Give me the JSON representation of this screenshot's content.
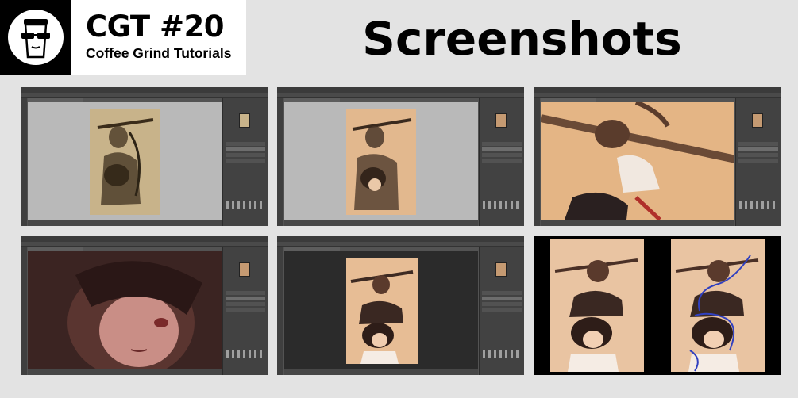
{
  "header": {
    "title": "CGT #20",
    "subtitle": "Coffee Grind Tutorials",
    "heading": "Screenshots"
  },
  "icons": {
    "logo": "coffee-cup-with-sunglasses-icon"
  },
  "colors": {
    "background": "#e3e3e3",
    "logo_bg": "#000000",
    "title_bg": "#ffffff",
    "ps_chrome": "#535353",
    "ps_workspace": "#b9b9b9",
    "canvas_skin": "#e2b68c",
    "stroke_blue": "#3040c0"
  },
  "screenshots": [
    {
      "id": "sketch-stage"
    },
    {
      "id": "base-color-stage"
    },
    {
      "id": "zoomed-weapon-detail"
    },
    {
      "id": "zoomed-face-detail"
    },
    {
      "id": "dark-workspace-refinement"
    },
    {
      "id": "before-after-comparison"
    }
  ]
}
